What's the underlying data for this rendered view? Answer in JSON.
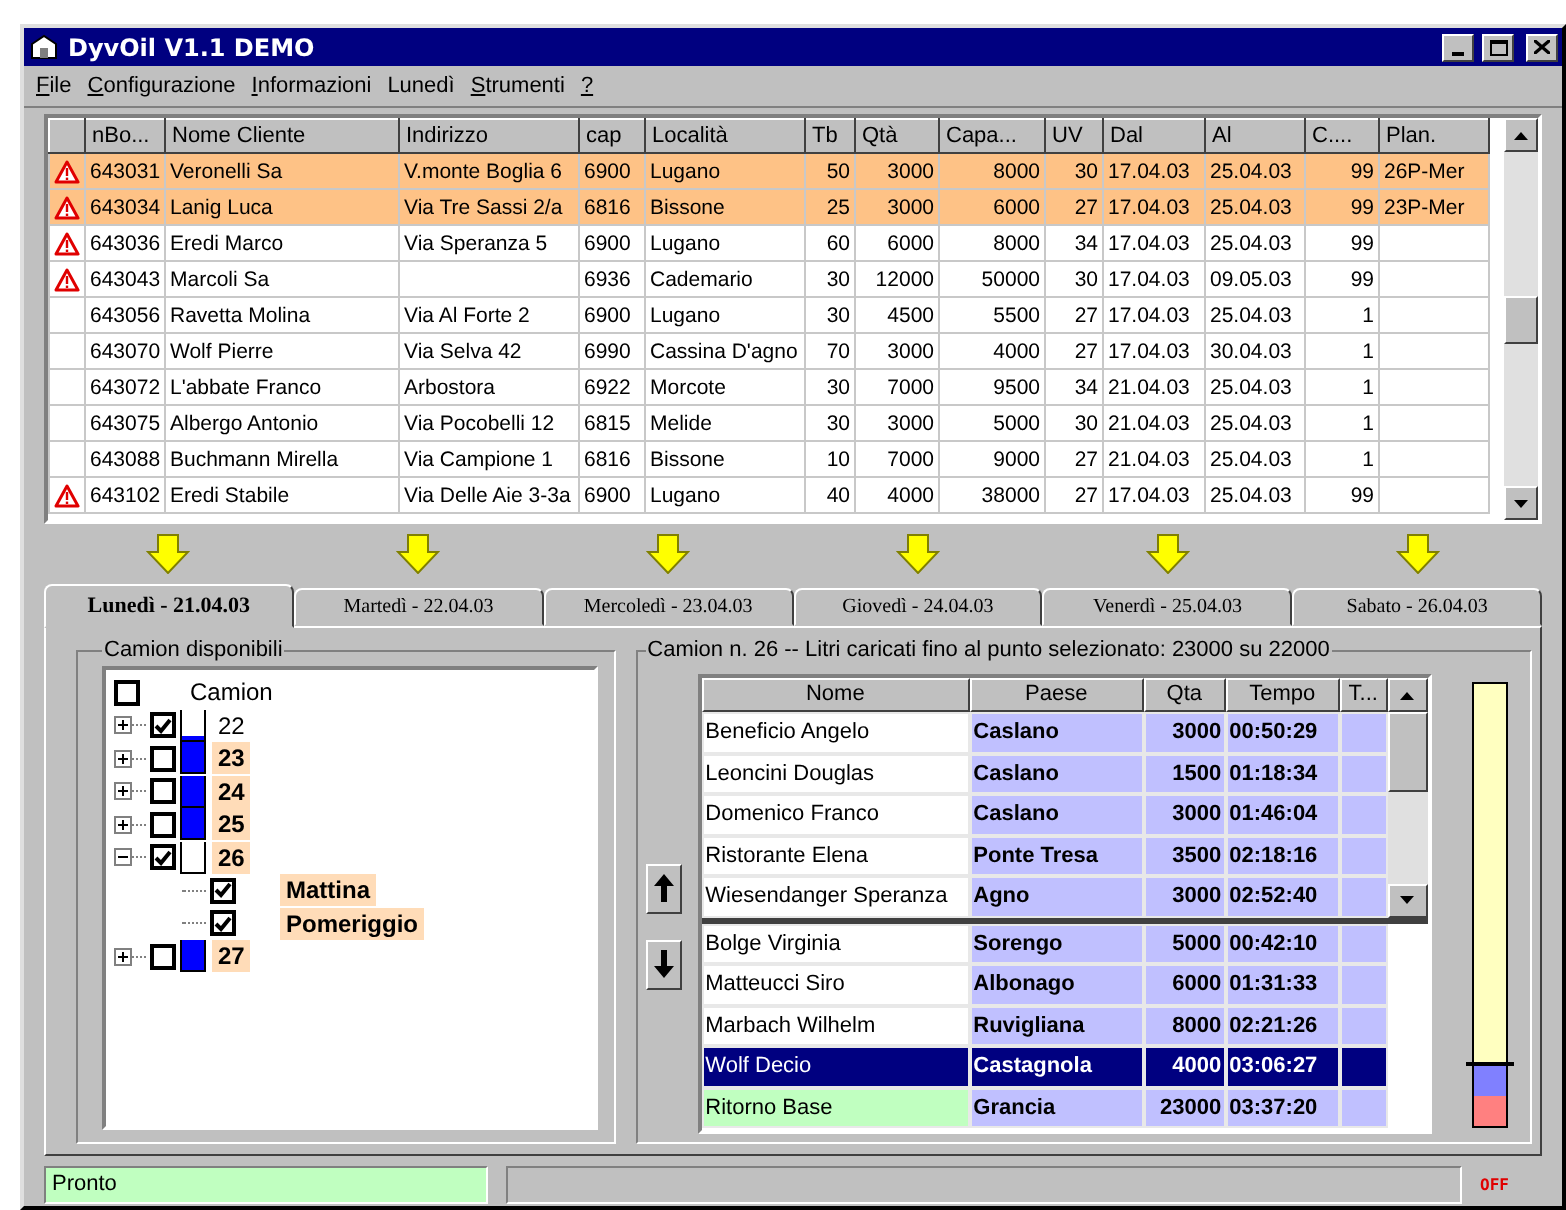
{
  "window": {
    "title": "DyvOil V1.1 DEMO"
  },
  "menu": [
    {
      "label": "File",
      "mnemonic": true
    },
    {
      "label": "Configurazione",
      "mnemonic": true
    },
    {
      "label": "Informazioni",
      "mnemonic": true
    },
    {
      "label": "Lunedì",
      "mnemonic": false
    },
    {
      "label": "Strumenti",
      "mnemonic": true
    },
    {
      "label": "?",
      "mnemonic": true
    }
  ],
  "grid": {
    "columns": [
      "nBo...",
      "Nome Cliente",
      "Indirizzo",
      "cap",
      "Località",
      "Tb",
      "Qtà",
      "Capa...",
      "UV",
      "Dal",
      "Al",
      "C....",
      "Plan."
    ],
    "rows": [
      {
        "warning": true,
        "highlighted": true,
        "cells": [
          "643031",
          "Veronelli Sa",
          "V.monte Boglia 6",
          "6900",
          "Lugano",
          "50",
          "3000",
          "8000",
          "30",
          "17.04.03",
          "25.04.03",
          "99",
          "26P-Mer"
        ]
      },
      {
        "warning": true,
        "highlighted": true,
        "cells": [
          "643034",
          "Lanig Luca",
          "Via Tre Sassi 2/a",
          "6816",
          "Bissone",
          "25",
          "3000",
          "6000",
          "27",
          "17.04.03",
          "25.04.03",
          "99",
          "23P-Mer"
        ]
      },
      {
        "warning": true,
        "highlighted": false,
        "cells": [
          "643036",
          "Eredi Marco",
          "Via Speranza 5",
          "6900",
          "Lugano",
          "60",
          "6000",
          "8000",
          "34",
          "17.04.03",
          "25.04.03",
          "99",
          null
        ]
      },
      {
        "warning": true,
        "highlighted": false,
        "cells": [
          "643043",
          "Marcoli Sa",
          null,
          "6936",
          "Cademario",
          "30",
          "12000",
          "50000",
          "30",
          "17.04.03",
          "09.05.03",
          "99",
          null
        ]
      },
      {
        "warning": false,
        "highlighted": false,
        "cells": [
          "643056",
          "Ravetta Molina",
          "Via Al Forte 2",
          "6900",
          "Lugano",
          "30",
          "4500",
          "5500",
          "27",
          "17.04.03",
          "25.04.03",
          "1",
          null
        ]
      },
      {
        "warning": false,
        "highlighted": false,
        "cells": [
          "643070",
          "Wolf Pierre",
          "Via Selva 42",
          "6990",
          "Cassina D'agno",
          "70",
          "3000",
          "4000",
          "27",
          "17.04.03",
          "30.04.03",
          "1",
          null
        ]
      },
      {
        "warning": false,
        "highlighted": false,
        "cells": [
          "643072",
          "L'abbate Franco",
          "Arbostora",
          "6922",
          "Morcote",
          "30",
          "7000",
          "9500",
          "34",
          "21.04.03",
          "25.04.03",
          "1",
          null
        ]
      },
      {
        "warning": false,
        "highlighted": false,
        "cells": [
          "643075",
          "Albergo Antonio",
          "Via Pocobelli 12",
          "6815",
          "Melide",
          "30",
          "3000",
          "5000",
          "30",
          "21.04.03",
          "25.04.03",
          "1",
          null
        ]
      },
      {
        "warning": false,
        "highlighted": false,
        "cells": [
          "643088",
          "Buchmann Mirella",
          "Via Campione 1",
          "6816",
          "Bissone",
          "10",
          "7000",
          "9000",
          "27",
          "21.04.03",
          "25.04.03",
          "1",
          null
        ]
      },
      {
        "warning": true,
        "highlighted": false,
        "cells": [
          "643102",
          "Eredi Stabile",
          "Via Delle Aie 3-3a",
          "6900",
          "Lugano",
          "40",
          "4000",
          "38000",
          "27",
          "17.04.03",
          "25.04.03",
          "99",
          null
        ]
      }
    ]
  },
  "tabs": [
    {
      "label": "Lunedì - 21.04.03",
      "selected": true
    },
    {
      "label": "Martedì - 22.04.03",
      "selected": false
    },
    {
      "label": "Mercoledì - 23.04.03",
      "selected": false
    },
    {
      "label": "Giovedì - 24.04.03",
      "selected": false
    },
    {
      "label": "Venerdì - 25.04.03",
      "selected": false
    },
    {
      "label": "Sabato - 26.04.03",
      "selected": false
    }
  ],
  "trucks_panel": {
    "title": "Camion disponibili",
    "tree": {
      "label": "Camion",
      "checked": false,
      "children": [
        {
          "label": "22",
          "checked": true,
          "expanded": false,
          "highlighted": false,
          "kind": "low"
        },
        {
          "label": "23",
          "checked": false,
          "expanded": false,
          "highlighted": true,
          "kind": "full"
        },
        {
          "label": "24",
          "checked": false,
          "expanded": false,
          "highlighted": true,
          "kind": "full"
        },
        {
          "label": "25",
          "checked": false,
          "expanded": false,
          "highlighted": true,
          "kind": "full"
        },
        {
          "label": "26",
          "checked": true,
          "expanded": true,
          "highlighted": true,
          "kind": "empty",
          "children": [
            {
              "label": "Mattina",
              "checked": true,
              "highlighted": true
            },
            {
              "label": "Pomeriggio",
              "checked": true,
              "highlighted": true
            }
          ]
        },
        {
          "label": "27",
          "checked": false,
          "expanded": false,
          "highlighted": true,
          "kind": "full"
        }
      ]
    }
  },
  "route_panel": {
    "title": "Camion n. 26 -- Litri caricati fino al punto selezionato: 23000 su 22000",
    "columns": [
      "Nome",
      "Paese",
      "Qta",
      "Tempo",
      "T..."
    ],
    "upper_rows": [
      {
        "kind": "stop",
        "selected": false,
        "nome": "Beneficio Angelo",
        "paese": "Caslano",
        "qta": "3000",
        "tempo": "00:50:29"
      },
      {
        "kind": "stop",
        "selected": false,
        "nome": "Leoncini Douglas",
        "paese": "Caslano",
        "qta": "1500",
        "tempo": "01:18:34"
      },
      {
        "kind": "stop",
        "selected": false,
        "nome": "Domenico Franco",
        "paese": "Caslano",
        "qta": "3000",
        "tempo": "01:46:04"
      },
      {
        "kind": "stop",
        "selected": false,
        "nome": "Ristorante Elena",
        "paese": "Ponte Tresa",
        "qta": "3500",
        "tempo": "02:18:16"
      },
      {
        "kind": "stop",
        "selected": false,
        "nome": "Wiesendanger Speranza",
        "paese": "Agno",
        "qta": "3000",
        "tempo": "02:52:40"
      }
    ],
    "lower_rows": [
      {
        "kind": "stop",
        "selected": false,
        "nome": "Bolge Virginia",
        "paese": "Sorengo",
        "qta": "5000",
        "tempo": "00:42:10"
      },
      {
        "kind": "stop",
        "selected": false,
        "nome": "Matteucci Siro",
        "paese": "Albonago",
        "qta": "6000",
        "tempo": "01:31:33"
      },
      {
        "kind": "stop",
        "selected": false,
        "nome": "Marbach Wilhelm",
        "paese": "Ruvigliana",
        "qta": "8000",
        "tempo": "02:21:26"
      },
      {
        "kind": "stop",
        "selected": true,
        "nome": "Wolf Decio",
        "paese": "Castagnola",
        "qta": "4000",
        "tempo": "03:06:27"
      },
      {
        "kind": "base",
        "selected": false,
        "nome": "Ritorno Base",
        "paese": "Grancia",
        "qta": "23000",
        "tempo": "03:37:20"
      }
    ],
    "gauge": {
      "segments": [
        {
          "color": "#ff8080",
          "level": 0.07
        },
        {
          "color": "#8080ff",
          "level": 0.07
        }
      ]
    }
  },
  "status_bar": {
    "message": "Pronto",
    "indicator": "OFF"
  }
}
